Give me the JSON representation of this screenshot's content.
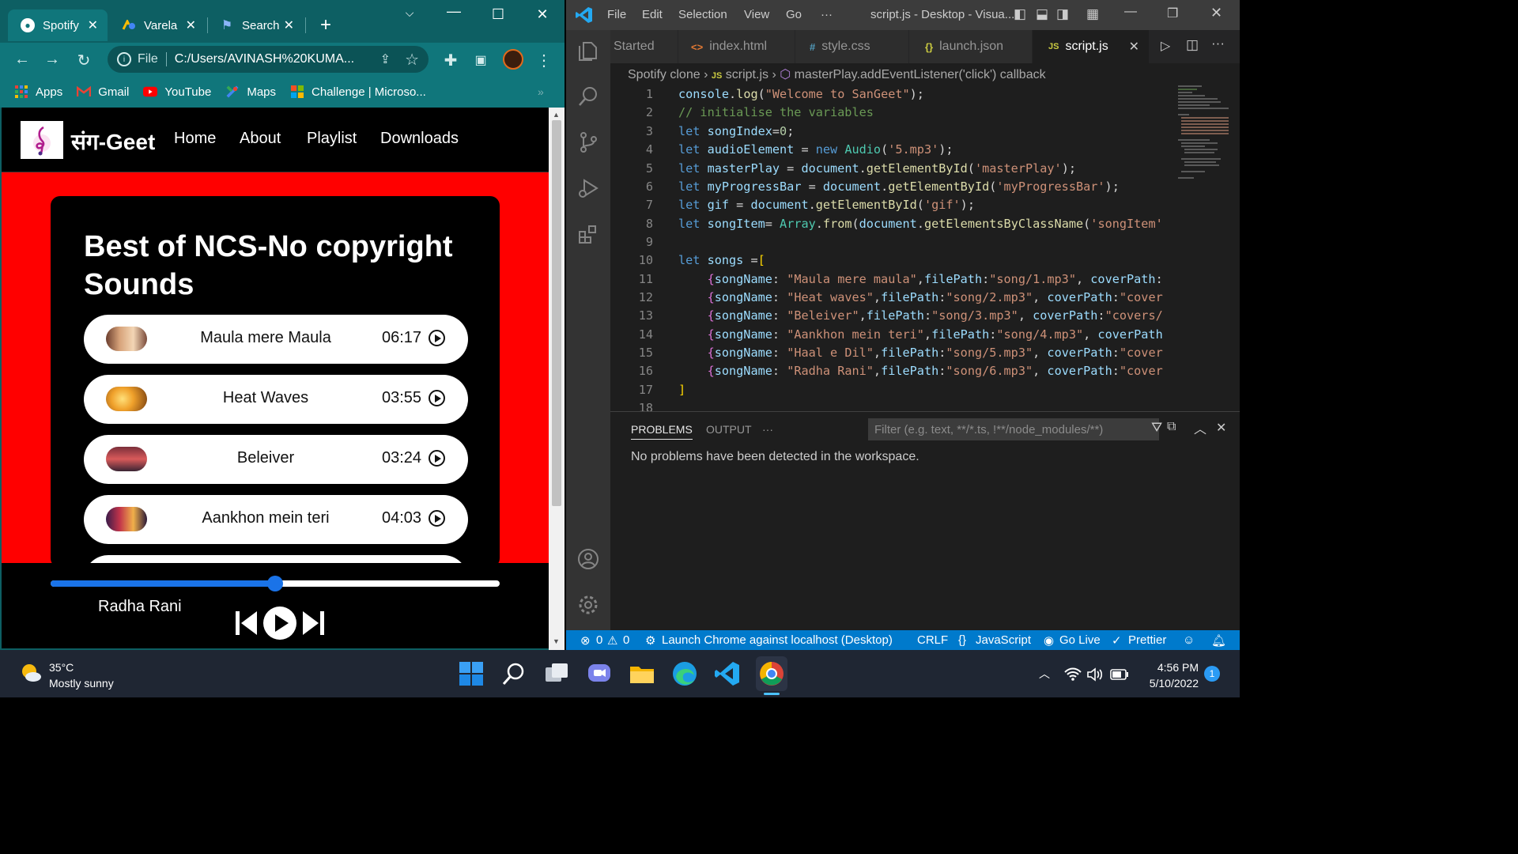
{
  "browser": {
    "tabs": [
      {
        "label": "Spotify",
        "active": true
      },
      {
        "label": "Varela",
        "active": false
      },
      {
        "label": "Search",
        "active": false
      }
    ],
    "omnibox": {
      "scheme": "File",
      "url": "C:/Users/AVINASH%20KUMA..."
    },
    "bookmarks": [
      "Apps",
      "Gmail",
      "YouTube",
      "Maps",
      "Challenge | Microso..."
    ]
  },
  "site": {
    "brand": "संग-Geet",
    "nav": [
      "Home",
      "About",
      "Playlist",
      "Downloads"
    ],
    "heading": "Best of NCS-No copyright Sounds",
    "songs": [
      {
        "name": "Maula mere Maula",
        "time": "06:17"
      },
      {
        "name": "Heat Waves",
        "time": "03:55"
      },
      {
        "name": "Beleiver",
        "time": "03:24"
      },
      {
        "name": "Aankhon mein teri",
        "time": "04:03"
      }
    ],
    "progress_fraction": 0.5,
    "now_playing": "Radha Rani"
  },
  "vscode": {
    "menu": [
      "File",
      "Edit",
      "Selection",
      "View",
      "Go",
      "···"
    ],
    "title": "script.js - Desktop - Visua...",
    "tabs": [
      "Started",
      "index.html",
      "style.css",
      "launch.json",
      "script.js"
    ],
    "breadcrumb": [
      "Spotify clone",
      "script.js",
      "masterPlay.addEventListener('click') callback"
    ],
    "panel_tabs": [
      "PROBLEMS",
      "OUTPUT",
      "···"
    ],
    "filter_placeholder": "Filter (e.g. text, **/*.ts, !**/node_modules/**)",
    "problems_message": "No problems have been detected in the workspace.",
    "status": {
      "errors": "0",
      "warnings": "0",
      "launch": "Launch Chrome against localhost (Desktop)",
      "eol": "CRLF",
      "language": "JavaScript",
      "live": "Go Live",
      "prettier": "Prettier"
    }
  },
  "taskbar": {
    "temperature": "35°C",
    "weather": "Mostly sunny",
    "time": "4:56 PM",
    "date": "5/10/2022",
    "notifications": "1"
  }
}
